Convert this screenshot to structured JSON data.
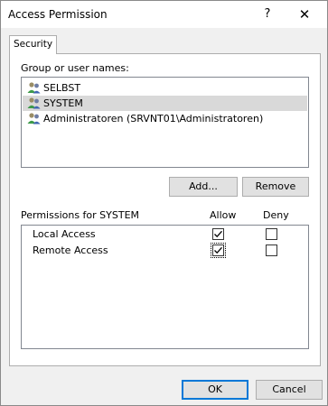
{
  "window": {
    "title": "Access Permission",
    "help_glyph": "?",
    "close_glyph": "✕"
  },
  "tabs": [
    {
      "label": "Security"
    }
  ],
  "group_label": "Group or user names:",
  "users": [
    {
      "name": "SELBST",
      "icon": "user-group-icon"
    },
    {
      "name": "SYSTEM",
      "icon": "user-group-icon",
      "selected": true
    },
    {
      "name": "Administratoren (SRVNT01\\Administratoren)",
      "icon": "user-group-icon"
    }
  ],
  "buttons": {
    "add": "Add...",
    "remove": "Remove",
    "ok": "OK",
    "cancel": "Cancel"
  },
  "permissions": {
    "header": "Permissions for SYSTEM",
    "allow_label": "Allow",
    "deny_label": "Deny",
    "rows": [
      {
        "name": "Local Access",
        "allow": true,
        "deny": false
      },
      {
        "name": "Remote Access",
        "allow": true,
        "deny": false
      }
    ]
  }
}
